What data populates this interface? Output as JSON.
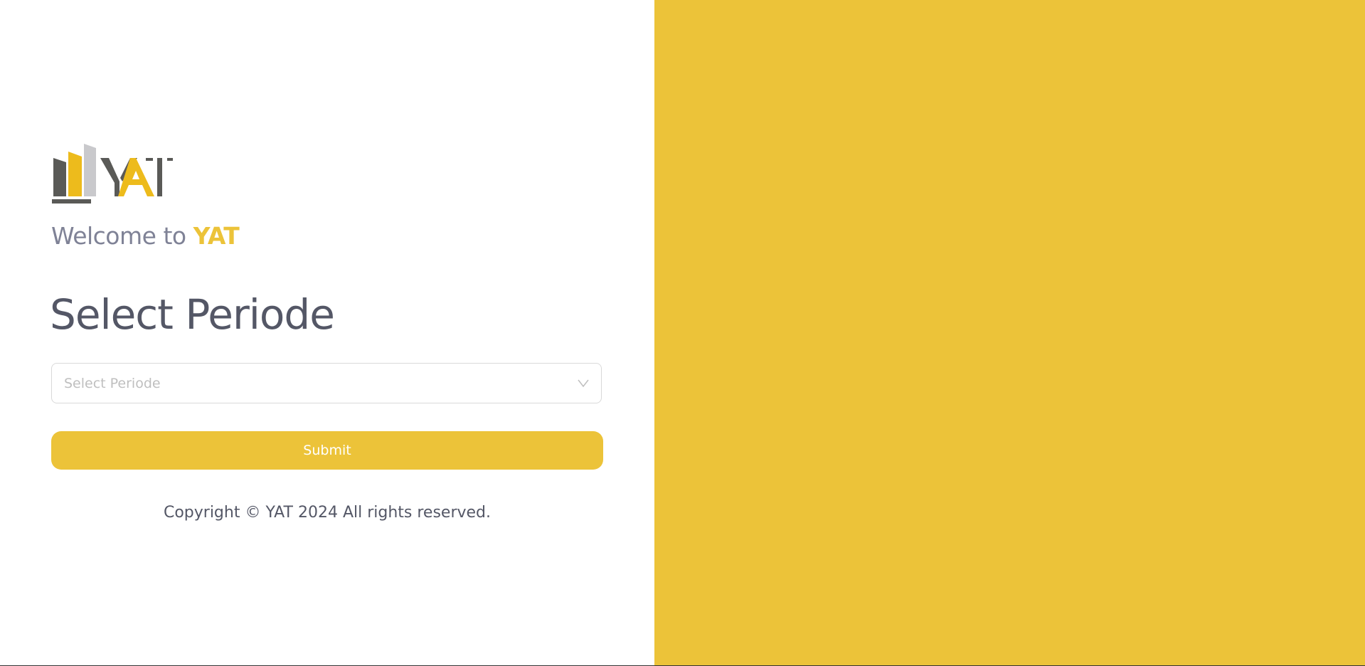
{
  "brand": {
    "logo_text": "YAT",
    "welcome_prefix": "Welcome to",
    "welcome_brand": "YAT"
  },
  "form": {
    "title": "Select Periode",
    "select": {
      "placeholder": "Select Periode",
      "value": "",
      "icon": "chevron-down-icon"
    },
    "submit_label": "Submit"
  },
  "footer": {
    "copyright": "Copyright © YAT 2024 All rights reserved."
  },
  "colors": {
    "accent": "#ECC339",
    "text_dark": "#545766",
    "text_muted": "#7f8296",
    "logo_dark": "#5a5a57",
    "logo_light": "#c9c9cc",
    "logo_yellow": "#EDBB1C"
  }
}
